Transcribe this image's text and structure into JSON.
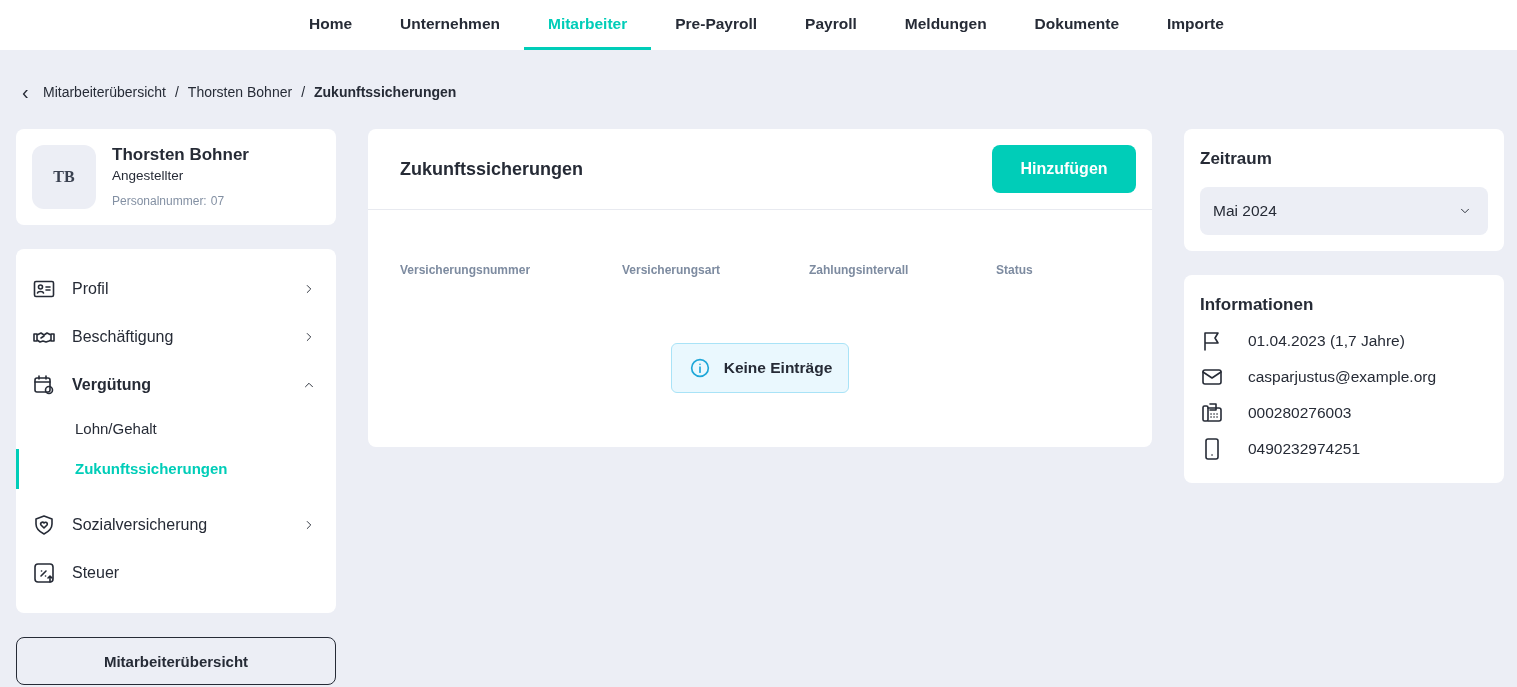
{
  "nav": {
    "tabs": [
      {
        "label": "Home",
        "selected": false
      },
      {
        "label": "Unternehmen",
        "selected": false
      },
      {
        "label": "Mitarbeiter",
        "selected": true
      },
      {
        "label": "Pre-Payroll",
        "selected": false
      },
      {
        "label": "Payroll",
        "selected": false
      },
      {
        "label": "Meldungen",
        "selected": false
      },
      {
        "label": "Dokumente",
        "selected": false
      },
      {
        "label": "Importe",
        "selected": false
      }
    ]
  },
  "breadcrumb": {
    "back": "‹",
    "items": [
      "Mitarbeiterübersicht",
      "Thorsten Bohner",
      "Zukunftssicherungen"
    ],
    "separator": "/"
  },
  "employee": {
    "initials": "TB",
    "name": "Thorsten Bohner",
    "role": "Angestellter",
    "number_label": "Personalnummer:",
    "number": "07"
  },
  "menu": [
    {
      "kind": "group",
      "label": "Profil",
      "expanded": false
    },
    {
      "kind": "group",
      "label": "Beschäftigung",
      "expanded": false
    },
    {
      "kind": "group",
      "label": "Vergütung",
      "expanded": true,
      "children": [
        {
          "label": "Lohn/Gehalt",
          "selected": false
        },
        {
          "label": "Zukunftssicherungen",
          "selected": true
        }
      ]
    },
    {
      "kind": "group",
      "label": "Sozialversicherung",
      "expanded": false
    },
    {
      "kind": "link",
      "label": "Steuer"
    }
  ],
  "overview_button": "Mitarbeiterübersicht",
  "main": {
    "title": "Zukunftssicherungen",
    "add_button": "Hinzufügen",
    "columns": [
      "Versicherungsnummer",
      "Versicherungsart",
      "Zahlungsintervall",
      "Status"
    ],
    "empty": "Keine Einträge"
  },
  "period": {
    "title": "Zeitraum",
    "value": "Mai 2024"
  },
  "info": {
    "title": "Informationen",
    "rows": [
      "01.04.2023 (1,7 Jahre)",
      "casparjustus@example.org",
      "000280276003",
      "0490232974251"
    ]
  }
}
